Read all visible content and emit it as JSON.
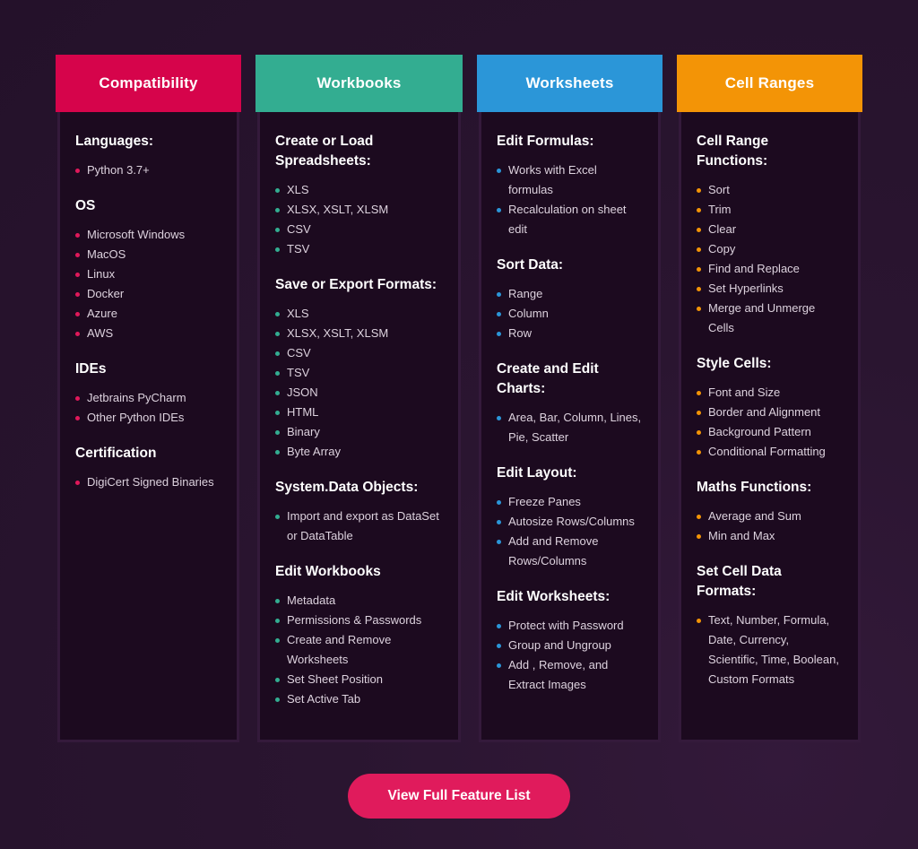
{
  "columns": [
    {
      "title": "Compatibility",
      "color": "#d6044b",
      "bullet_color": "#e0185a",
      "sections": [
        {
          "heading": "Languages:",
          "items": [
            "Python 3.7+"
          ]
        },
        {
          "heading": "OS",
          "items": [
            "Microsoft Windows",
            "MacOS",
            "Linux",
            "Docker",
            "Azure",
            "AWS"
          ]
        },
        {
          "heading": "IDEs",
          "items": [
            "Jetbrains PyCharm",
            "Other Python IDEs"
          ]
        },
        {
          "heading": "Certification",
          "items": [
            "DigiCert Signed Binaries"
          ]
        }
      ]
    },
    {
      "title": "Workbooks",
      "color": "#33ad91",
      "bullet_color": "#33ad91",
      "sections": [
        {
          "heading": "Create or Load Spreadsheets:",
          "items": [
            "XLS",
            "XLSX, XSLT, XLSM",
            "CSV",
            "TSV"
          ]
        },
        {
          "heading": "Save or Export Formats:",
          "items": [
            "XLS",
            "XLSX, XSLT, XLSM",
            "CSV",
            "TSV",
            "JSON",
            "HTML",
            "Binary",
            "Byte Array"
          ]
        },
        {
          "heading": "System.Data Objects:",
          "items": [
            "Import and export as DataSet or DataTable"
          ]
        },
        {
          "heading": "Edit Workbooks",
          "items": [
            "Metadata",
            "Permissions & Passwords",
            "Create and Remove Worksheets",
            "Set Sheet Position",
            "Set Active Tab"
          ]
        }
      ]
    },
    {
      "title": "Worksheets",
      "color": "#2b96d8",
      "bullet_color": "#2b96d8",
      "sections": [
        {
          "heading": "Edit Formulas:",
          "items": [
            "Works with Excel formulas",
            "Recalculation on sheet edit"
          ]
        },
        {
          "heading": "Sort Data:",
          "items": [
            "Range",
            "Column",
            "Row"
          ]
        },
        {
          "heading": "Create and Edit Charts:",
          "items": [
            "Area, Bar, Column, Lines, Pie, Scatter"
          ]
        },
        {
          "heading": "Edit Layout:",
          "items": [
            "Freeze Panes",
            "Autosize Rows/Columns",
            "Add and Remove Rows/Columns"
          ]
        },
        {
          "heading": "Edit Worksheets:",
          "items": [
            "Protect with Password",
            "Group and Ungroup",
            "Add , Remove, and Extract Images"
          ]
        }
      ]
    },
    {
      "title": "Cell Ranges",
      "color": "#f39406",
      "bullet_color": "#f39406",
      "sections": [
        {
          "heading": "Cell Range Functions:",
          "items": [
            "Sort",
            "Trim",
            "Clear",
            "Copy",
            "Find and Replace",
            "Set Hyperlinks",
            "Merge and Unmerge Cells"
          ]
        },
        {
          "heading": "Style Cells:",
          "items": [
            "Font and Size",
            "Border and Alignment",
            "Background Pattern",
            "Conditional Formatting"
          ]
        },
        {
          "heading": "Maths Functions:",
          "items": [
            "Average and Sum",
            "Min and Max"
          ]
        },
        {
          "heading": "Set Cell Data Formats:",
          "items": [
            "Text, Number, Formula, Date, Currency, Scientific, Time, Boolean, Custom Formats"
          ]
        }
      ]
    }
  ],
  "cta": {
    "label": "View Full Feature List",
    "color": "#e01b5c"
  }
}
